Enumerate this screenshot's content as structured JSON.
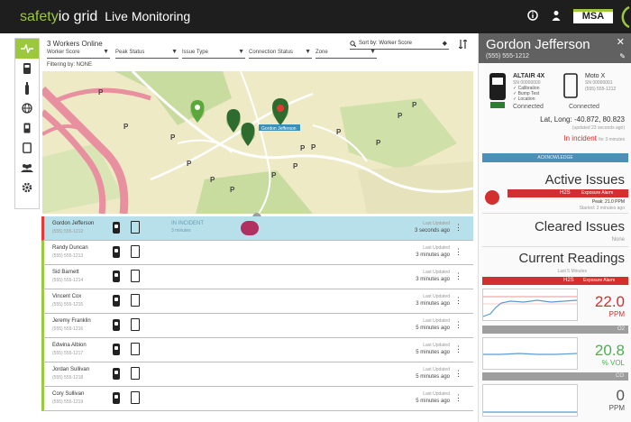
{
  "app": {
    "brand_part1": "safety",
    "brand_part2": "io grid",
    "page_title": "Live Monitoring",
    "logo": "MSA"
  },
  "topbar_icons": [
    "info-icon",
    "user-icon"
  ],
  "rail": [
    "activity-icon",
    "device-icon",
    "gas-cylinder-icon",
    "globe-icon",
    "phone-icon",
    "tablet-icon",
    "team-icon",
    "settings-icon"
  ],
  "header": {
    "workers_online": "3 Workers Online",
    "filters": [
      "Worker Score",
      "Peak Status",
      "Issue Type",
      "Connection Status",
      "Zone"
    ],
    "filtering_by": "Filtering by: NONE",
    "sort_by": "Sort by: Worker Score"
  },
  "map": {
    "marker_label": "Gordon Jefferson"
  },
  "workers": [
    {
      "name": "Gordon Jefferson",
      "phone": "(555) 555-1212",
      "status": "IN INCIDENT",
      "status_time": "3 minutes",
      "seen_label": "Last Updated",
      "seen_time": "3 seconds ago",
      "selected": true
    },
    {
      "name": "Randy Duncan",
      "phone": "(555) 555-1213",
      "status": "",
      "status_time": "",
      "seen_label": "Last Updated",
      "seen_time": "3 minutes ago",
      "selected": false
    },
    {
      "name": "Sid Barnett",
      "phone": "(555) 555-1214",
      "status": "",
      "status_time": "",
      "seen_label": "Last Updated",
      "seen_time": "3 minutes ago",
      "selected": false
    },
    {
      "name": "Vincent Cox",
      "phone": "(555) 555-1215",
      "status": "",
      "status_time": "",
      "seen_label": "Last Updated",
      "seen_time": "3 minutes ago",
      "selected": false
    },
    {
      "name": "Jeremy Franklin",
      "phone": "(555) 555-1216",
      "status": "",
      "status_time": "",
      "seen_label": "Last Updated",
      "seen_time": "5 minutes ago",
      "selected": false
    },
    {
      "name": "Edwina Albion",
      "phone": "(555) 555-1217",
      "status": "",
      "status_time": "",
      "seen_label": "Last Updated",
      "seen_time": "5 minutes ago",
      "selected": false
    },
    {
      "name": "Jordan Sullivan",
      "phone": "(555) 555-1218",
      "status": "",
      "status_time": "",
      "seen_label": "Last Updated",
      "seen_time": "5 minutes ago",
      "selected": false
    },
    {
      "name": "Cory Sullivan",
      "phone": "(555) 555-1219",
      "status": "",
      "status_time": "",
      "seen_label": "Last Updated",
      "seen_time": "5 minutes ago",
      "selected": false
    }
  ],
  "panel": {
    "name": "Gordon Jefferson",
    "phone": "(555) 555-1212",
    "device1": {
      "title": "ALTAIR 4X",
      "serial": "SN 00000000",
      "lines": [
        "✓ Calibration",
        "✓ Bump Test",
        "✓ Location"
      ],
      "status": "Connected"
    },
    "device2": {
      "title": "Moto X",
      "serial": "SN 00000001",
      "lines": [
        "(555) 555-1212"
      ],
      "status": "Connected"
    },
    "latlong": "Lat, Long: -40.872, 80.823",
    "latlong_sub": "(updated 23 seconds ago)",
    "incident": "In incident",
    "incident_time": "for 3 minutes",
    "acknowledge": "ACKNOWLEDGE",
    "active_title": "Active Issues",
    "active_gas": "H2S",
    "active_label": "Exposure Alarm",
    "active_peak": "Peak: 21.0 PPM",
    "active_since": "Started: 3 minutes ago",
    "cleared_title": "Cleared Issues",
    "cleared_none": "None",
    "readings_title": "Current Readings",
    "readings_sub": "Last 5 Minutes",
    "readings": [
      {
        "gas": "H2S",
        "label": "Exposure Alarm",
        "value": "22.0",
        "unit": "PPM",
        "color": "#d32f2f",
        "alarm": true
      },
      {
        "gas": "O2",
        "label": "",
        "value": "20.8",
        "unit": "% VOL",
        "color": "#4caf50",
        "alarm": false
      },
      {
        "gas": "CO",
        "label": "",
        "value": "0",
        "unit": "PPM",
        "color": "#555555",
        "alarm": false
      }
    ]
  }
}
